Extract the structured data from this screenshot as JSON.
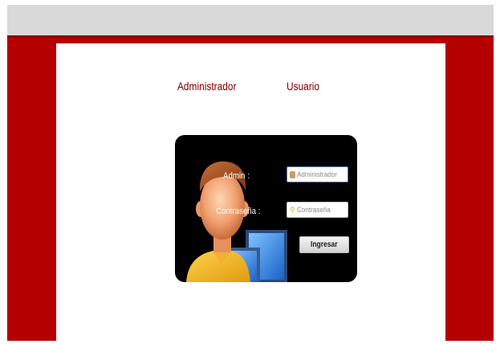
{
  "tabs": {
    "admin_label": "Administrador",
    "user_label": "Usuario"
  },
  "login": {
    "admin_label": "Admin :",
    "password_label": "Contraseña :",
    "admin_placeholder": "Administrador",
    "password_placeholder": "Contraseña",
    "submit_label": "Ingresar"
  },
  "colors": {
    "background_red": "#b50000",
    "tab_text": "#8a0000",
    "card_background": "#000000"
  },
  "icons": {
    "admin_field": "user-icon",
    "password_field": "key-icon",
    "illustration": "user-at-computer-illustration"
  }
}
